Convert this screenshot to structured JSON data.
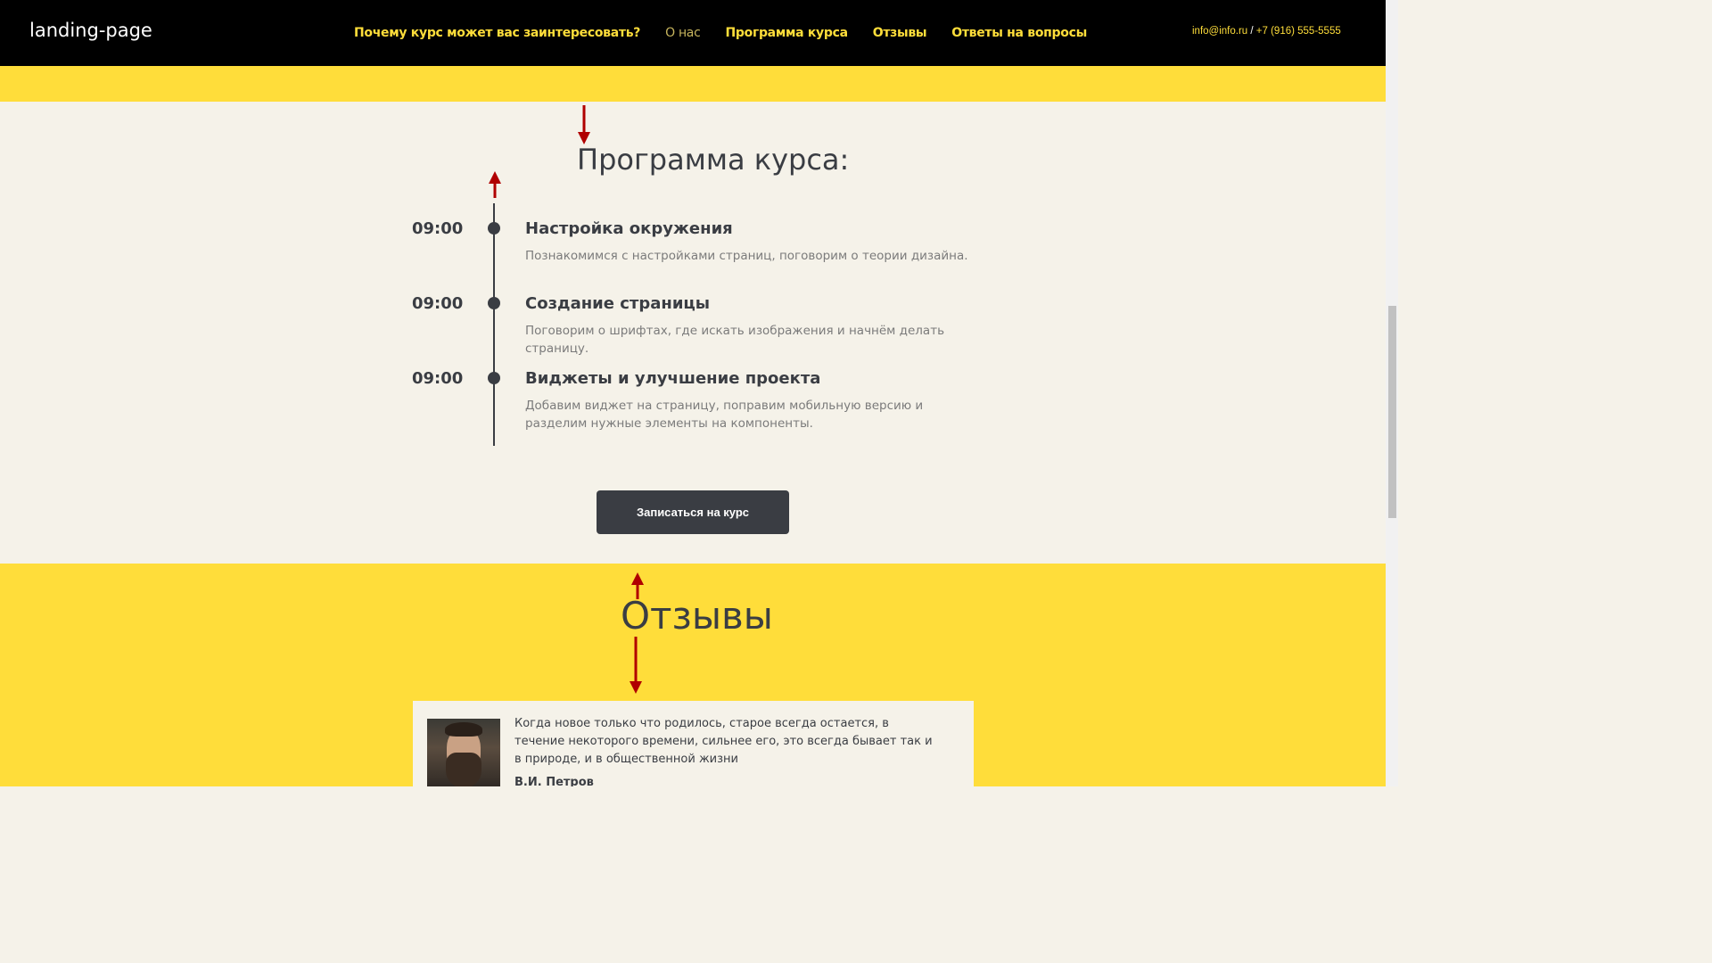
{
  "header": {
    "logo": "landing-page",
    "nav": [
      {
        "label": "Почему курс может вас заинтересовать?"
      },
      {
        "label": "О нас"
      },
      {
        "label": "Программа курса"
      },
      {
        "label": "Отзывы"
      },
      {
        "label": "Ответы на вопросы"
      }
    ],
    "email": "info@info.ru",
    "separator": "/",
    "phone": "+7 (916) 555-5555"
  },
  "program": {
    "title": "Программа курса:",
    "items": [
      {
        "time": "09:00",
        "title": "Настройка окружения",
        "description": "Познакомимся с настройками страниц, поговорим о теории дизайна."
      },
      {
        "time": "09:00",
        "title": "Создание страницы",
        "description": "Поговорим о шрифтах, где искать изображения и начнём делать страницу."
      },
      {
        "time": "09:00",
        "title": "Виджеты и улучшение проекта",
        "description": "Добавим виджет на страницу, поправим мобильную версию и разделим нужные элементы на компоненты."
      }
    ],
    "cta_label": "Записаться на курс"
  },
  "reviews": {
    "title": "Отзывы",
    "items": [
      {
        "text": "Когда новое только что родилось, старое всегда остается, в течение некоторого времени, сильнее его, это всегда бывает так и в природе, и в общественной жизни",
        "author": "В.И. Петров"
      }
    ]
  },
  "colors": {
    "header_bg": "#000000",
    "accent_yellow": "#ffdd3a",
    "nav_text": "#ffde3a",
    "section_bg": "#f5f2e9",
    "dark": "#3a3d43",
    "arrow_red": "#b00000"
  }
}
